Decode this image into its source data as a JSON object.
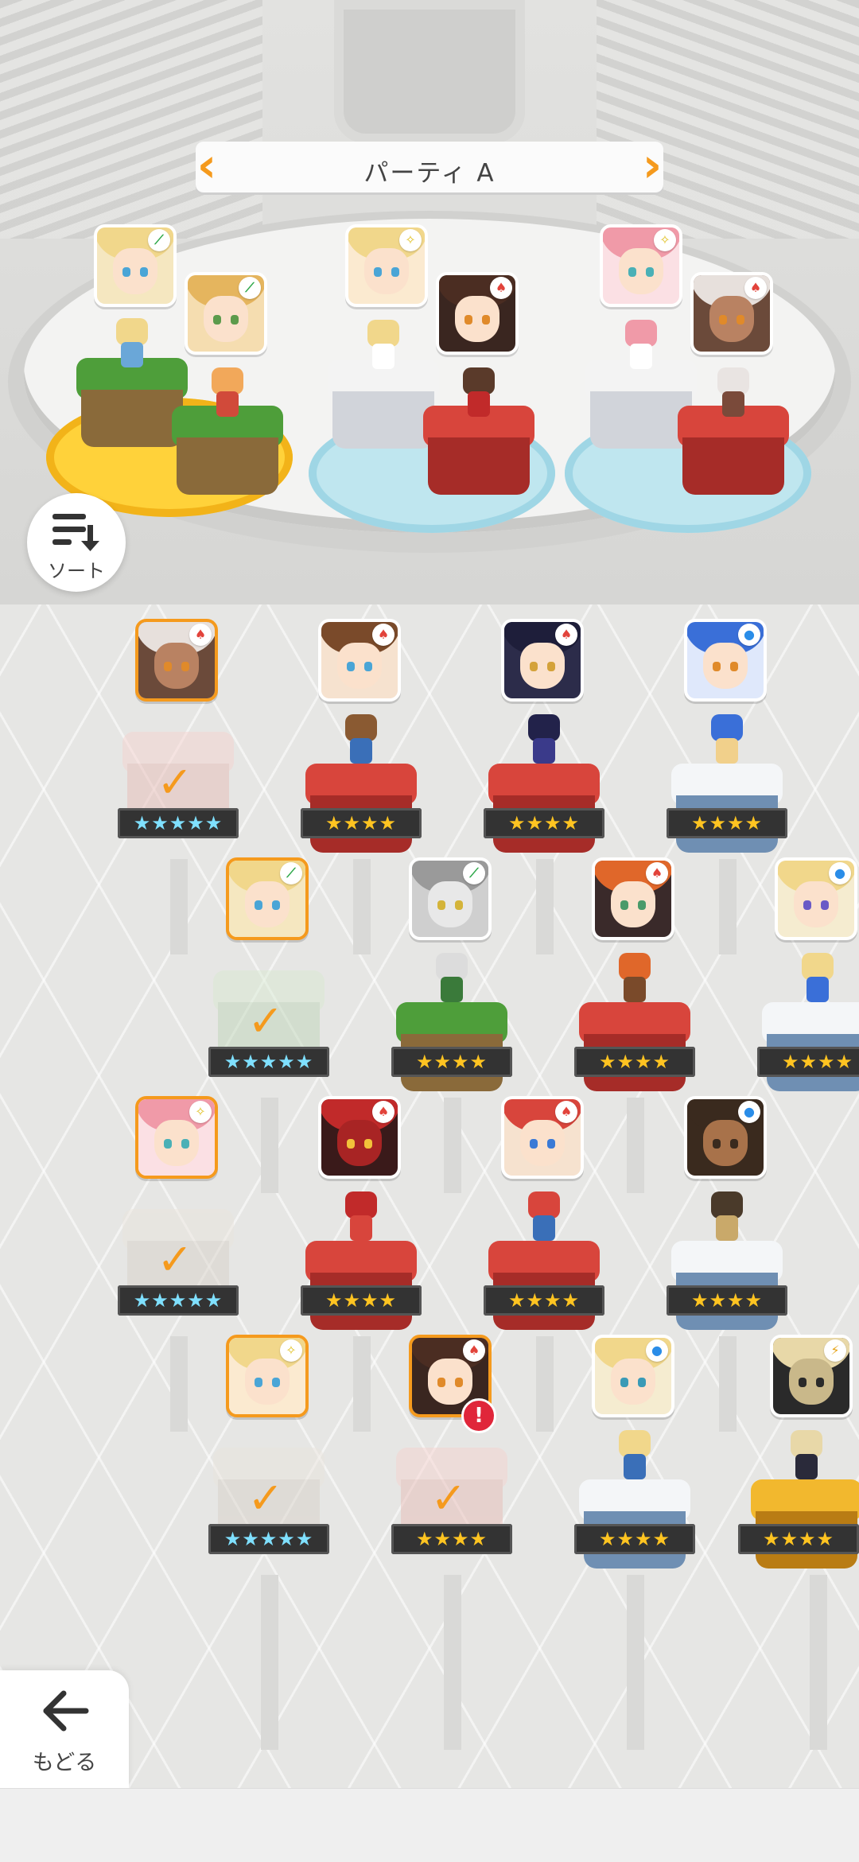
{
  "party": {
    "title": "パーティ A"
  },
  "sort": {
    "label": "ソート"
  },
  "back": {
    "label": "もどる"
  },
  "stars": {
    "five": "★★★★★",
    "four": "★★★★"
  },
  "marks": {
    "check": "✓",
    "alert": "!"
  },
  "element_icons": {
    "fire": "♠︎",
    "water": "●",
    "wind": "⟋",
    "light": "✧",
    "thunder": "⚡"
  },
  "roster": [
    {
      "row": 1,
      "col": 1,
      "element": "fire",
      "rarity": 5,
      "selected": true
    },
    {
      "row": 1,
      "col": 2,
      "element": "fire",
      "rarity": 4,
      "selected": false
    },
    {
      "row": 1,
      "col": 3,
      "element": "fire",
      "rarity": 4,
      "selected": false
    },
    {
      "row": 1,
      "col": 4,
      "element": "water",
      "rarity": 4,
      "selected": false
    },
    {
      "row": 2,
      "col": 1,
      "element": "wind",
      "rarity": 5,
      "selected": true
    },
    {
      "row": 2,
      "col": 2,
      "element": "wind",
      "rarity": 4,
      "selected": false
    },
    {
      "row": 2,
      "col": 3,
      "element": "fire",
      "rarity": 4,
      "selected": false
    },
    {
      "row": 2,
      "col": 4,
      "element": "water",
      "rarity": 4,
      "selected": false
    },
    {
      "row": 3,
      "col": 1,
      "element": "light",
      "rarity": 5,
      "selected": true
    },
    {
      "row": 3,
      "col": 2,
      "element": "fire",
      "rarity": 4,
      "selected": false
    },
    {
      "row": 3,
      "col": 3,
      "element": "fire",
      "rarity": 4,
      "selected": false
    },
    {
      "row": 3,
      "col": 4,
      "element": "water",
      "rarity": 4,
      "selected": false
    },
    {
      "row": 4,
      "col": 1,
      "element": "light",
      "rarity": 5,
      "selected": true
    },
    {
      "row": 4,
      "col": 2,
      "element": "fire",
      "rarity": 4,
      "selected": true,
      "alert": true
    },
    {
      "row": 4,
      "col": 3,
      "element": "water",
      "rarity": 4,
      "selected": false
    },
    {
      "row": 4,
      "col": 4,
      "element": "thunder",
      "rarity": 4,
      "selected": false
    }
  ],
  "party_slots": [
    {
      "slot": 1,
      "elements": [
        "wind",
        "wind"
      ]
    },
    {
      "slot": 2,
      "elements": [
        "light",
        "fire"
      ]
    },
    {
      "slot": 3,
      "elements": [
        "light",
        "fire"
      ]
    }
  ]
}
